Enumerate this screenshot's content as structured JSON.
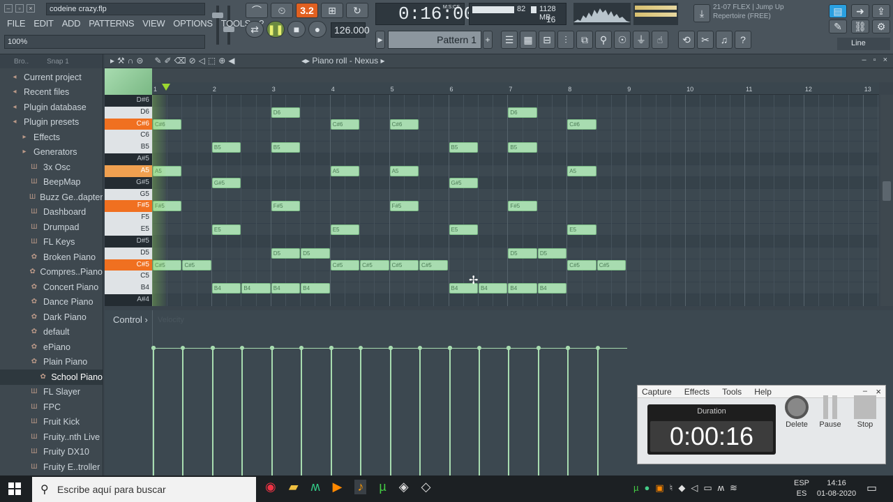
{
  "window": {
    "filename": "codeine crazy.flp",
    "zoom": "100%"
  },
  "menu": [
    "FILE",
    "EDIT",
    "ADD",
    "PATTERNS",
    "VIEW",
    "OPTIONS",
    "TOOLS",
    "?"
  ],
  "transport": {
    "time": "0:16:00",
    "time_unit": "M:S:CS",
    "tempo": "126.000",
    "pattern": "Pattern 1",
    "snap_display": "3.2",
    "cpu": "82",
    "memory": "1128 MB",
    "polyphony": "16"
  },
  "news": {
    "date": "21-07",
    "text": "FLEX | Jump Up",
    "sub": "Repertoire (FREE)"
  },
  "tool_mode": "Line",
  "browser": {
    "toolbar": {
      "label": "Bro..",
      "snap": "Snap 1"
    },
    "items": [
      {
        "label": "Current project",
        "icon": "project-icon",
        "level": 0
      },
      {
        "label": "Recent files",
        "icon": "recent-icon",
        "level": 0
      },
      {
        "label": "Plugin database",
        "icon": "database-icon",
        "level": 0
      },
      {
        "label": "Plugin presets",
        "icon": "presets-icon",
        "level": 0
      },
      {
        "label": "Effects",
        "icon": "folder-icon",
        "level": 1
      },
      {
        "label": "Generators",
        "icon": "folder-icon",
        "level": 1
      },
      {
        "label": "3x Osc",
        "icon": "plugin-icon",
        "level": 2
      },
      {
        "label": "BeepMap",
        "icon": "plugin-icon",
        "level": 2
      },
      {
        "label": "Buzz Ge..dapter",
        "icon": "plugin-icon",
        "level": 2
      },
      {
        "label": "Dashboard",
        "icon": "plugin-icon",
        "level": 2
      },
      {
        "label": "Drumpad",
        "icon": "plugin-icon",
        "level": 2
      },
      {
        "label": "FL Keys",
        "icon": "plugin-icon",
        "level": 2
      },
      {
        "label": "Broken Piano",
        "icon": "preset-icon",
        "level": 2
      },
      {
        "label": "Compres..Piano",
        "icon": "preset-icon",
        "level": 2
      },
      {
        "label": "Concert Piano",
        "icon": "preset-icon",
        "level": 2
      },
      {
        "label": "Dance Piano",
        "icon": "preset-icon",
        "level": 2
      },
      {
        "label": "Dark Piano",
        "icon": "preset-icon",
        "level": 2
      },
      {
        "label": "default",
        "icon": "preset-icon",
        "level": 2
      },
      {
        "label": "ePiano",
        "icon": "preset-icon",
        "level": 2
      },
      {
        "label": "Plain Piano",
        "icon": "preset-icon",
        "level": 2
      },
      {
        "label": "School Piano",
        "icon": "preset-icon",
        "level": 3
      },
      {
        "label": "FL Slayer",
        "icon": "plugin-icon",
        "level": 2
      },
      {
        "label": "FPC",
        "icon": "plugin-icon",
        "level": 2
      },
      {
        "label": "Fruit Kick",
        "icon": "plugin-icon",
        "level": 2
      },
      {
        "label": "Fruity..nth Live",
        "icon": "plugin-icon",
        "level": 2
      },
      {
        "label": "Fruity DX10",
        "icon": "plugin-icon",
        "level": 2
      },
      {
        "label": "Fruity E..troller",
        "icon": "plugin-icon",
        "level": 2
      }
    ]
  },
  "pianoroll": {
    "title": "Piano roll - Nexus",
    "ruler": [
      "1",
      "2",
      "3",
      "4",
      "5",
      "6",
      "7",
      "8",
      "9",
      "10",
      "11",
      "12",
      "13"
    ],
    "keys": [
      {
        "label": "D#6",
        "type": "b"
      },
      {
        "label": "D6",
        "type": "w"
      },
      {
        "label": "C#6",
        "type": "sel"
      },
      {
        "label": "C6",
        "type": "w"
      },
      {
        "label": "B5",
        "type": "w"
      },
      {
        "label": "A#5",
        "type": "b"
      },
      {
        "label": "A5",
        "type": "sel2"
      },
      {
        "label": "G#5",
        "type": "b"
      },
      {
        "label": "G5",
        "type": "w"
      },
      {
        "label": "F#5",
        "type": "sel"
      },
      {
        "label": "F5",
        "type": "w"
      },
      {
        "label": "E5",
        "type": "w"
      },
      {
        "label": "D#5",
        "type": "b"
      },
      {
        "label": "D5",
        "type": "w"
      },
      {
        "label": "C#5",
        "type": "sel"
      },
      {
        "label": "C5",
        "type": "w"
      },
      {
        "label": "B4",
        "type": "w"
      },
      {
        "label": "A#4",
        "type": "b"
      }
    ],
    "notes": [
      {
        "pitch": "C#6",
        "bar": 1.0,
        "len": 0.5
      },
      {
        "pitch": "A5",
        "bar": 1.0,
        "len": 0.5
      },
      {
        "pitch": "F#5",
        "bar": 1.0,
        "len": 0.5
      },
      {
        "pitch": "C#5",
        "bar": 1.0,
        "len": 0.5
      },
      {
        "pitch": "C#5",
        "bar": 1.5,
        "len": 0.5
      },
      {
        "pitch": "B5",
        "bar": 2.0,
        "len": 0.5
      },
      {
        "pitch": "G#5",
        "bar": 2.0,
        "len": 0.5
      },
      {
        "pitch": "E5",
        "bar": 2.0,
        "len": 0.5
      },
      {
        "pitch": "B4",
        "bar": 2.0,
        "len": 0.5
      },
      {
        "pitch": "B4",
        "bar": 2.5,
        "len": 0.5
      },
      {
        "pitch": "D6",
        "bar": 3.0,
        "len": 0.5
      },
      {
        "pitch": "B5",
        "bar": 3.0,
        "len": 0.5
      },
      {
        "pitch": "F#5",
        "bar": 3.0,
        "len": 0.5
      },
      {
        "pitch": "D5",
        "bar": 3.0,
        "len": 0.5
      },
      {
        "pitch": "D5",
        "bar": 3.5,
        "len": 0.5
      },
      {
        "pitch": "B4",
        "bar": 3.0,
        "len": 0.5
      },
      {
        "pitch": "B4",
        "bar": 3.5,
        "len": 0.5
      },
      {
        "pitch": "C#6",
        "bar": 4.0,
        "len": 0.5
      },
      {
        "pitch": "A5",
        "bar": 4.0,
        "len": 0.5
      },
      {
        "pitch": "E5",
        "bar": 4.0,
        "len": 0.5
      },
      {
        "pitch": "C#5",
        "bar": 4.0,
        "len": 0.5
      },
      {
        "pitch": "C#5",
        "bar": 4.5,
        "len": 0.5
      },
      {
        "pitch": "C#6",
        "bar": 5.0,
        "len": 0.5
      },
      {
        "pitch": "A5",
        "bar": 5.0,
        "len": 0.5
      },
      {
        "pitch": "F#5",
        "bar": 5.0,
        "len": 0.5
      },
      {
        "pitch": "C#5",
        "bar": 5.0,
        "len": 0.5
      },
      {
        "pitch": "C#5",
        "bar": 5.5,
        "len": 0.5
      },
      {
        "pitch": "B5",
        "bar": 6.0,
        "len": 0.5
      },
      {
        "pitch": "G#5",
        "bar": 6.0,
        "len": 0.5
      },
      {
        "pitch": "E5",
        "bar": 6.0,
        "len": 0.5
      },
      {
        "pitch": "B4",
        "bar": 6.0,
        "len": 0.5
      },
      {
        "pitch": "B4",
        "bar": 6.5,
        "len": 0.5
      },
      {
        "pitch": "D6",
        "bar": 7.0,
        "len": 0.5
      },
      {
        "pitch": "B5",
        "bar": 7.0,
        "len": 0.5
      },
      {
        "pitch": "F#5",
        "bar": 7.0,
        "len": 0.5
      },
      {
        "pitch": "D5",
        "bar": 7.0,
        "len": 0.5
      },
      {
        "pitch": "D5",
        "bar": 7.5,
        "len": 0.5
      },
      {
        "pitch": "B4",
        "bar": 7.0,
        "len": 0.5
      },
      {
        "pitch": "B4",
        "bar": 7.5,
        "len": 0.5
      },
      {
        "pitch": "C#6",
        "bar": 8.0,
        "len": 0.5
      },
      {
        "pitch": "A5",
        "bar": 8.0,
        "len": 0.5
      },
      {
        "pitch": "E5",
        "bar": 8.0,
        "len": 0.5
      },
      {
        "pitch": "C#5",
        "bar": 8.0,
        "len": 0.5
      },
      {
        "pitch": "C#5",
        "bar": 8.5,
        "len": 0.5
      }
    ],
    "control_label": "Control",
    "control_param": "Velocity"
  },
  "capture": {
    "menu": [
      "Capture",
      "Effects",
      "Tools",
      "Help"
    ],
    "duration_label": "Duration",
    "duration": "0:00:16",
    "buttons": [
      "Delete",
      "Pause",
      "Stop"
    ]
  },
  "taskbar": {
    "search_placeholder": "Escribe aquí para buscar",
    "lang_top": "ESP",
    "lang_bottom": "ES",
    "time": "14:16",
    "date": "01-08-2020"
  }
}
